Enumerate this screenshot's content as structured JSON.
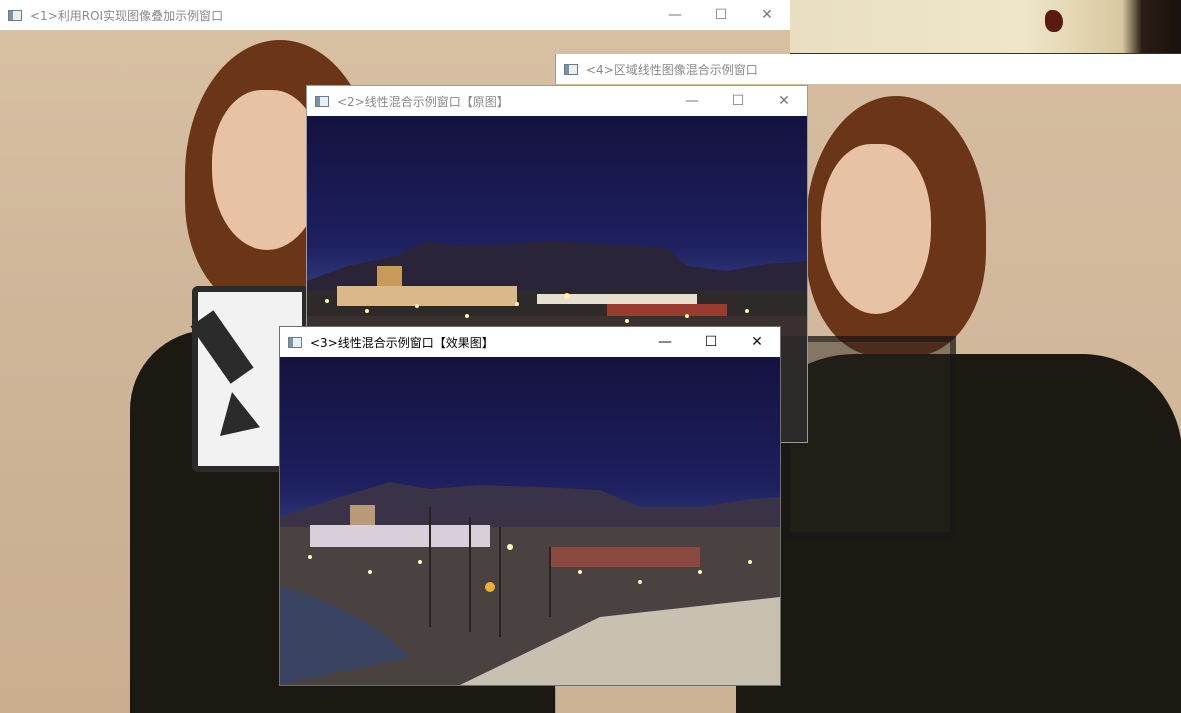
{
  "windows": {
    "w1": {
      "title": "<1>利用ROI实现图像叠加示例窗口"
    },
    "w2": {
      "title": "<2>线性混合示例窗口【原图】"
    },
    "w3": {
      "title": "<3>线性混合示例窗口【效果图】"
    },
    "w4": {
      "title": "<4>区域线性图像混合示例窗口"
    }
  },
  "controls": {
    "minimize": "—",
    "maximize": "☐",
    "close": "✕"
  },
  "colors": {
    "sky_top": "#14123f",
    "titlebar": "#ffffff",
    "active_text": "#000000",
    "inactive_text": "#888888"
  }
}
